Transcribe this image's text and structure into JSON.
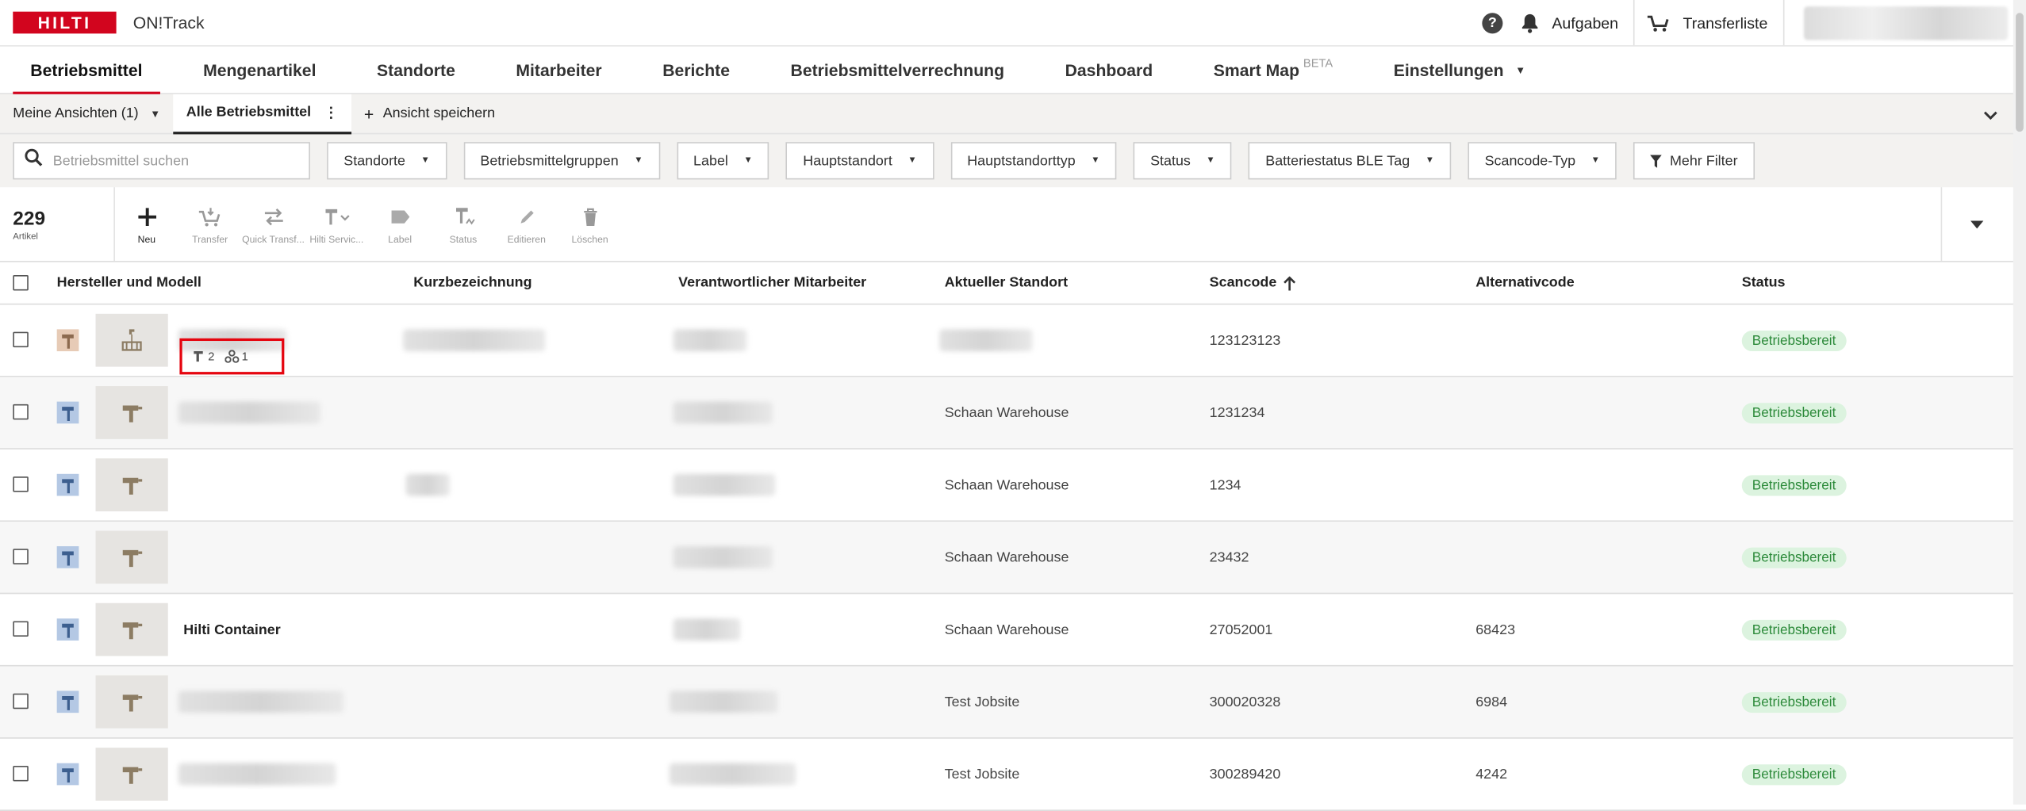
{
  "app": {
    "brand": "HILTI",
    "name": "ON!Track"
  },
  "top": {
    "help": "?",
    "tasks_label": "Aufgaben",
    "transfer_list_label": "Transferliste"
  },
  "nav": [
    {
      "label": "Betriebsmittel",
      "active": true
    },
    {
      "label": "Mengenartikel"
    },
    {
      "label": "Standorte"
    },
    {
      "label": "Mitarbeiter"
    },
    {
      "label": "Berichte"
    },
    {
      "label": "Betriebsmittelverrechnung"
    },
    {
      "label": "Dashboard"
    },
    {
      "label": "Smart Map",
      "badge": "BETA"
    },
    {
      "label": "Einstellungen",
      "dropdown": true
    }
  ],
  "views": {
    "my_views": "Meine Ansichten (1)",
    "current": "Alle Betriebsmittel",
    "save": "Ansicht speichern"
  },
  "search": {
    "placeholder": "Betriebsmittel suchen"
  },
  "filters": [
    "Standorte",
    "Betriebsmittelgruppen",
    "Label",
    "Hauptstandort",
    "Hauptstandorttyp",
    "Status",
    "Batteriestatus BLE Tag",
    "Scancode-Typ"
  ],
  "more_filters": "Mehr Filter",
  "count": {
    "value": "229",
    "label": "Artikel"
  },
  "tools": [
    {
      "label": "Neu",
      "icon": "plus-icon",
      "enabled": true
    },
    {
      "label": "Transfer",
      "icon": "transfer-cart-icon"
    },
    {
      "label": "Quick Transf...",
      "icon": "quick-transfer-icon"
    },
    {
      "label": "Hilti Servic...",
      "icon": "hilti-service-icon"
    },
    {
      "label": "Label",
      "icon": "label-tag-icon"
    },
    {
      "label": "Status",
      "icon": "status-tool-icon"
    },
    {
      "label": "Editieren",
      "icon": "pencil-icon"
    },
    {
      "label": "Löschen",
      "icon": "trash-icon"
    }
  ],
  "table": {
    "headers": {
      "model": "Hersteller und Modell",
      "short": "Kurzbezeichnung",
      "responsible": "Verantwortlicher Mitarbeiter",
      "location": "Aktueller Standort",
      "scancode": "Scancode",
      "altcode": "Alternativcode",
      "status": "Status"
    },
    "rows": [
      {
        "type": "container",
        "model": "",
        "child_assets": "2",
        "child_groups": "1",
        "location": "",
        "scancode": "123123123",
        "altcode": "",
        "status": "Betriebsbereit"
      },
      {
        "type": "asset",
        "model": "",
        "location": "Schaan Warehouse",
        "scancode": "1231234",
        "altcode": "",
        "status": "Betriebsbereit"
      },
      {
        "type": "asset",
        "model": "",
        "location": "Schaan Warehouse",
        "scancode": "1234",
        "altcode": "",
        "status": "Betriebsbereit"
      },
      {
        "type": "asset",
        "model": "",
        "location": "Schaan Warehouse",
        "scancode": "23432",
        "altcode": "",
        "status": "Betriebsbereit"
      },
      {
        "type": "asset",
        "model": "Hilti Container",
        "location": "Schaan Warehouse",
        "scancode": "27052001",
        "altcode": "68423",
        "status": "Betriebsbereit"
      },
      {
        "type": "asset",
        "model": "",
        "location": "Test Jobsite",
        "scancode": "300020328",
        "altcode": "6984",
        "status": "Betriebsbereit"
      },
      {
        "type": "asset",
        "model": "",
        "location": "Test Jobsite",
        "scancode": "300289420",
        "altcode": "4242",
        "status": "Betriebsbereit"
      }
    ]
  },
  "colors": {
    "brand_red": "#d2051e",
    "status_green_bg": "#dcf3df",
    "status_green_text": "#2c8a3a",
    "highlight": "#e5050f"
  }
}
